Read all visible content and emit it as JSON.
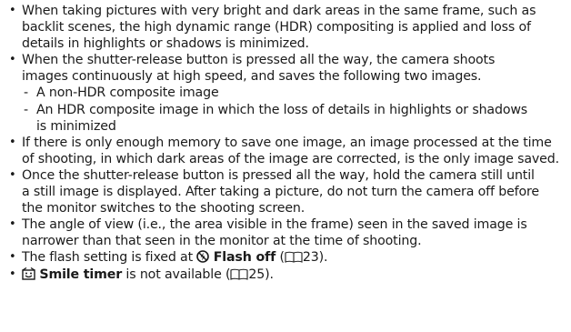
{
  "bullets": [
    {
      "lines": [
        "When taking pictures with very bright and dark areas in the same frame, such as",
        "backlit scenes, the high dynamic range (HDR) compositing is applied and loss of",
        "details in highlights or shadows is minimized."
      ]
    },
    {
      "lines": [
        "When the shutter-release button is pressed all the way, the camera shoots",
        "images continuously at high speed, and saves the following two images."
      ],
      "sub_items": [
        {
          "dash": "-",
          "lines": [
            "A non-HDR composite image"
          ]
        },
        {
          "dash": "-",
          "lines": [
            "An HDR composite image in which the loss of details in highlights or shadows",
            "is minimized"
          ]
        }
      ]
    },
    {
      "lines": [
        "If there is only enough memory to save one image, an image processed at the time",
        "of shooting, in which dark areas of the image are corrected, is the only image saved."
      ]
    },
    {
      "lines": [
        "Once the shutter-release button is pressed all the way, hold the camera still until",
        "a still image is displayed. After taking a picture, do not turn the camera off before",
        "the monitor switches to the shooting screen."
      ]
    },
    {
      "lines": [
        "The angle of view (i.e., the area visible in the frame) seen in the saved image is",
        "narrower than that seen in the monitor at the time of shooting."
      ]
    }
  ],
  "flash_item": {
    "prefix": "The flash setting is fixed at ",
    "icon": "flash-off-icon",
    "bold_label": "Flash off",
    "open_paren": " (",
    "ref_icon": "book-reference-icon",
    "page": "23",
    "suffix": ")."
  },
  "smile_item": {
    "icon": "smile-timer-icon",
    "bold_label": "Smile timer",
    "text": " is not available (",
    "ref_icon": "book-reference-icon",
    "page": "25",
    "suffix": ")."
  },
  "bullet_char": "•"
}
